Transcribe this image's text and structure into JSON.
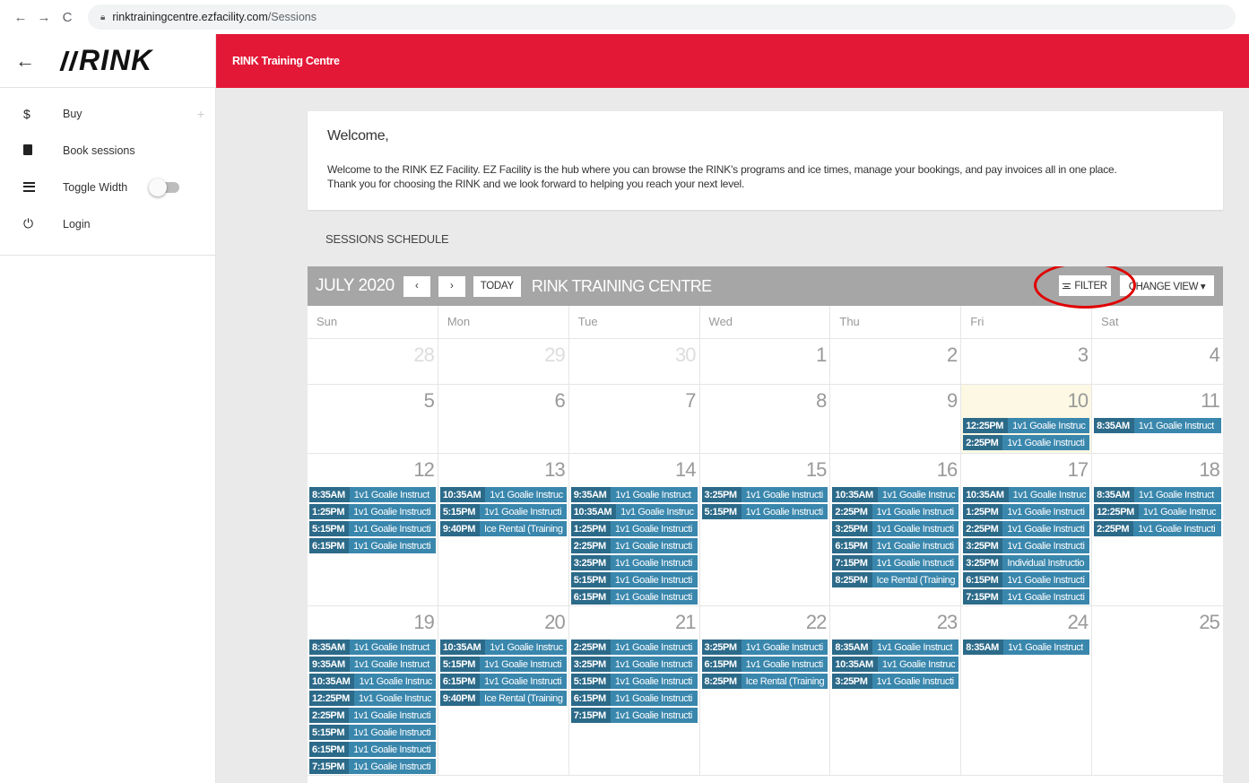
{
  "browser": {
    "url_host": "rinktrainingcentre.ezfacility.com",
    "url_path": "/Sessions"
  },
  "sidebar": {
    "logo": "RINK",
    "items": [
      {
        "icon": "dollar-icon",
        "label": "Buy"
      },
      {
        "icon": "book-icon",
        "label": "Book sessions"
      },
      {
        "icon": "indent-icon",
        "label": "Toggle Width"
      },
      {
        "icon": "power-icon",
        "label": "Login"
      }
    ]
  },
  "header": {
    "title": "RINK Training Centre"
  },
  "welcome": {
    "title": "Welcome,",
    "line1": "Welcome to the RINK EZ Facility. EZ Facility is the hub where you can browse the RINK's programs and ice times, manage your bookings, and pay invoices all in one place.",
    "line2": "Thank you for choosing the RINK and we look forward to helping you reach your next level."
  },
  "schedule_label": "SESSIONS SCHEDULE",
  "calendar": {
    "month": "JULY 2020",
    "prev": "‹",
    "next": "›",
    "today": "TODAY",
    "venue": "RINK TRAINING CENTRE",
    "filter": "FILTER",
    "change_view": "CHANGE VIEW ▾",
    "dows": [
      "Sun",
      "Mon",
      "Tue",
      "Wed",
      "Thu",
      "Fri",
      "Sat"
    ],
    "event_color": "#3a87ad",
    "today_color": "#fcf8e3",
    "weeks": [
      {
        "height": 51,
        "days": [
          {
            "num": "28",
            "other": true,
            "events": []
          },
          {
            "num": "29",
            "other": true,
            "events": []
          },
          {
            "num": "30",
            "other": true,
            "events": []
          },
          {
            "num": "1",
            "events": []
          },
          {
            "num": "2",
            "events": []
          },
          {
            "num": "3",
            "events": []
          },
          {
            "num": "4",
            "events": []
          }
        ]
      },
      {
        "height": 77,
        "days": [
          {
            "num": "5",
            "events": []
          },
          {
            "num": "6",
            "events": []
          },
          {
            "num": "7",
            "events": []
          },
          {
            "num": "8",
            "events": []
          },
          {
            "num": "9",
            "events": []
          },
          {
            "num": "10",
            "today": true,
            "events": [
              {
                "time": "12:25PM",
                "desc": "1v1 Goalie Instruc"
              },
              {
                "time": "2:25PM",
                "desc": "1v1 Goalie Instructi"
              }
            ]
          },
          {
            "num": "11",
            "events": [
              {
                "time": "8:35AM",
                "desc": "1v1 Goalie Instruct"
              }
            ]
          }
        ]
      },
      {
        "height": 170,
        "days": [
          {
            "num": "12",
            "events": [
              {
                "time": "8:35AM",
                "desc": "1v1 Goalie Instruct"
              },
              {
                "time": "1:25PM",
                "desc": "1v1 Goalie Instructi"
              },
              {
                "time": "5:15PM",
                "desc": "1v1 Goalie Instructi"
              },
              {
                "time": "6:15PM",
                "desc": "1v1 Goalie Instructi"
              }
            ]
          },
          {
            "num": "13",
            "events": [
              {
                "time": "10:35AM",
                "desc": "1v1 Goalie Instruc"
              },
              {
                "time": "5:15PM",
                "desc": "1v1 Goalie Instructi"
              },
              {
                "time": "9:40PM",
                "desc": "Ice Rental (Training"
              }
            ]
          },
          {
            "num": "14",
            "events": [
              {
                "time": "9:35AM",
                "desc": "1v1 Goalie Instruct"
              },
              {
                "time": "10:35AM",
                "desc": "1v1 Goalie Instruc"
              },
              {
                "time": "1:25PM",
                "desc": "1v1 Goalie Instructi"
              },
              {
                "time": "2:25PM",
                "desc": "1v1 Goalie Instructi"
              },
              {
                "time": "3:25PM",
                "desc": "1v1 Goalie Instructi"
              },
              {
                "time": "5:15PM",
                "desc": "1v1 Goalie Instructi"
              },
              {
                "time": "6:15PM",
                "desc": "1v1 Goalie Instructi"
              }
            ]
          },
          {
            "num": "15",
            "events": [
              {
                "time": "3:25PM",
                "desc": "1v1 Goalie Instructi"
              },
              {
                "time": "5:15PM",
                "desc": "1v1 Goalie Instructi"
              }
            ]
          },
          {
            "num": "16",
            "events": [
              {
                "time": "10:35AM",
                "desc": "1v1 Goalie Instruc"
              },
              {
                "time": "2:25PM",
                "desc": "1v1 Goalie Instructi"
              },
              {
                "time": "3:25PM",
                "desc": "1v1 Goalie Instructi"
              },
              {
                "time": "6:15PM",
                "desc": "1v1 Goalie Instructi"
              },
              {
                "time": "7:15PM",
                "desc": "1v1 Goalie Instructi"
              },
              {
                "time": "8:25PM",
                "desc": "Ice Rental (Training"
              }
            ]
          },
          {
            "num": "17",
            "events": [
              {
                "time": "10:35AM",
                "desc": "1v1 Goalie Instruc"
              },
              {
                "time": "1:25PM",
                "desc": "1v1 Goalie Instructi"
              },
              {
                "time": "2:25PM",
                "desc": "1v1 Goalie Instructi"
              },
              {
                "time": "3:25PM",
                "desc": "1v1 Goalie Instructi"
              },
              {
                "time": "3:25PM",
                "desc": "Individual Instructio"
              },
              {
                "time": "6:15PM",
                "desc": "1v1 Goalie Instructi"
              },
              {
                "time": "7:15PM",
                "desc": "1v1 Goalie Instructi"
              }
            ]
          },
          {
            "num": "18",
            "events": [
              {
                "time": "8:35AM",
                "desc": "1v1 Goalie Instruct"
              },
              {
                "time": "12:25PM",
                "desc": "1v1 Goalie Instruc"
              },
              {
                "time": "2:25PM",
                "desc": "1v1 Goalie Instructi"
              }
            ]
          }
        ]
      },
      {
        "height": 189,
        "days": [
          {
            "num": "19",
            "events": [
              {
                "time": "8:35AM",
                "desc": "1v1 Goalie Instruct"
              },
              {
                "time": "9:35AM",
                "desc": "1v1 Goalie Instruct"
              },
              {
                "time": "10:35AM",
                "desc": "1v1 Goalie Instruc"
              },
              {
                "time": "12:25PM",
                "desc": "1v1 Goalie Instruc"
              },
              {
                "time": "2:25PM",
                "desc": "1v1 Goalie Instructi"
              },
              {
                "time": "5:15PM",
                "desc": "1v1 Goalie Instructi"
              },
              {
                "time": "6:15PM",
                "desc": "1v1 Goalie Instructi"
              },
              {
                "time": "7:15PM",
                "desc": "1v1 Goalie Instructi"
              }
            ]
          },
          {
            "num": "20",
            "events": [
              {
                "time": "10:35AM",
                "desc": "1v1 Goalie Instruc"
              },
              {
                "time": "5:15PM",
                "desc": "1v1 Goalie Instructi"
              },
              {
                "time": "6:15PM",
                "desc": "1v1 Goalie Instructi"
              },
              {
                "time": "9:40PM",
                "desc": "Ice Rental (Training"
              }
            ]
          },
          {
            "num": "21",
            "events": [
              {
                "time": "2:25PM",
                "desc": "1v1 Goalie Instructi"
              },
              {
                "time": "3:25PM",
                "desc": "1v1 Goalie Instructi"
              },
              {
                "time": "5:15PM",
                "desc": "1v1 Goalie Instructi"
              },
              {
                "time": "6:15PM",
                "desc": "1v1 Goalie Instructi"
              },
              {
                "time": "7:15PM",
                "desc": "1v1 Goalie Instructi"
              }
            ]
          },
          {
            "num": "22",
            "events": [
              {
                "time": "3:25PM",
                "desc": "1v1 Goalie Instructi"
              },
              {
                "time": "6:15PM",
                "desc": "1v1 Goalie Instructi"
              },
              {
                "time": "8:25PM",
                "desc": "Ice Rental (Training"
              }
            ]
          },
          {
            "num": "23",
            "events": [
              {
                "time": "8:35AM",
                "desc": "1v1 Goalie Instruct"
              },
              {
                "time": "10:35AM",
                "desc": "1v1 Goalie Instruc"
              },
              {
                "time": "3:25PM",
                "desc": "1v1 Goalie Instructi"
              }
            ]
          },
          {
            "num": "24",
            "events": [
              {
                "time": "8:35AM",
                "desc": "1v1 Goalie Instruct"
              }
            ]
          },
          {
            "num": "25",
            "events": []
          }
        ]
      }
    ]
  }
}
